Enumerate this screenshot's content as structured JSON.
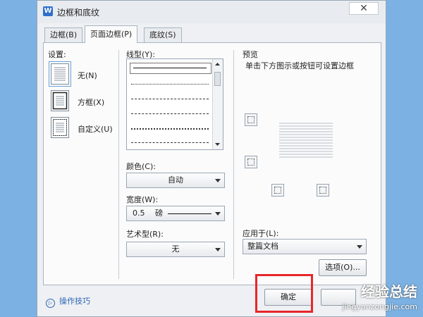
{
  "window": {
    "title": "边框和底纹",
    "app_icon": "W",
    "close_glyph": "✕"
  },
  "tabs": [
    {
      "label": "边框(B)"
    },
    {
      "label": "页面边框(P)"
    },
    {
      "label": "底纹(S)"
    }
  ],
  "settings": {
    "label": "设置:",
    "items": [
      {
        "label": "无(N)"
      },
      {
        "label": "方框(X)"
      },
      {
        "label": "自定义(U)"
      }
    ]
  },
  "line_style": {
    "label": "线型(Y):"
  },
  "color": {
    "label": "颜色(C):",
    "value": "自动"
  },
  "width": {
    "label": "宽度(W):",
    "value": "0.5",
    "unit": "磅"
  },
  "art": {
    "label": "艺术型(R):",
    "value": "无"
  },
  "preview": {
    "label": "预览",
    "hint": "单击下方图示或按钮可设置边框"
  },
  "apply_to": {
    "label": "应用于(L):",
    "value": "整篇文档"
  },
  "buttons": {
    "options": "选项(O)...",
    "ok": "确定"
  },
  "tips": {
    "label": "操作技巧",
    "icon_glyph": "▷"
  },
  "watermark": {
    "title": "经验总结",
    "url": "jingyanzongjie.com"
  },
  "colors": {
    "accent": "#2b66b5",
    "highlight": "#e8262a",
    "background": "#7bb1e3"
  }
}
